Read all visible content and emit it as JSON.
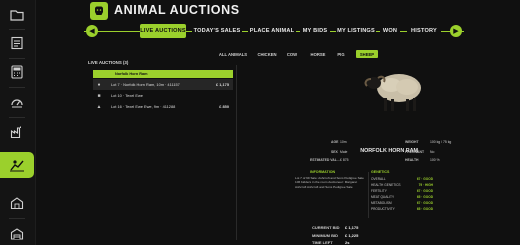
{
  "header": {
    "title": "ANIMAL AUCTIONS",
    "logo_icon": "cow-head-icon"
  },
  "tabs": {
    "prev_icon": "chevron-left-icon",
    "next_icon": "chevron-right-icon",
    "items": [
      {
        "label": "LIVE AUCTIONS",
        "active": true
      },
      {
        "label": "TODAY'S SALES",
        "active": false
      },
      {
        "label": "PLACE ANIMAL",
        "active": false
      },
      {
        "label": "MY BIDS",
        "active": false
      },
      {
        "label": "MY LISTINGS",
        "active": false
      },
      {
        "label": "WON",
        "active": false
      },
      {
        "label": "HISTORY",
        "active": false
      }
    ]
  },
  "filters": [
    {
      "label": "ALL ANIMALS",
      "active": false
    },
    {
      "label": "CHICKEN",
      "active": false
    },
    {
      "label": "COW",
      "active": false
    },
    {
      "label": "HORSE",
      "active": false
    },
    {
      "label": "PIG",
      "active": false
    },
    {
      "label": "SHEEP",
      "active": true
    }
  ],
  "auctions": {
    "title": "LIVE AUCTIONS (3)",
    "group_header": "Norfolk Horn Ram",
    "rows": [
      {
        "icon": "sheep-icon",
        "text": "Lot 7  ·  Norfolk Horn Ram, 10m  ·  411157",
        "price": "£ 1,175",
        "selected": true
      },
      {
        "icon": "cow-icon",
        "text": "Lot 10  ·  Texel Ewe",
        "price": "",
        "selected": false
      },
      {
        "icon": "horse-icon",
        "text": "Lot 16  ·  Texel Ewe Ewe, 9m  ·  411288",
        "price": "£ 850",
        "selected": false
      }
    ]
  },
  "details": {
    "animal_icon": "sheep-icon",
    "name": "NORFOLK HORN RAM",
    "stats": {
      "age_label": "AGE",
      "age_value": "10m",
      "weight_label": "WEIGHT",
      "weight_value": "100 kg / 75 kg",
      "sex_label": "SEX",
      "sex_value": "Male",
      "pregnant_label": "PREGNANT",
      "pregnant_value": "No",
      "est_label": "ESTIMATED VAL...",
      "est_value": "£ 875",
      "health_label": "HEALTH",
      "health_value": "100 %"
    },
    "information": {
      "title": "INFORMATION",
      "text": "Lot 7 of 99 Sale: Ashcroft and Sons Pedigree Sale 106 bidders in the room Auctioneer: Margaret Ashcroft Ashcroft and Sons Pedigree Sale"
    },
    "genetics": {
      "title": "GENETICS",
      "rows": [
        {
          "label": "OVERALL",
          "value": "67 · GOOD"
        },
        {
          "label": "HEALTH GENETICS",
          "value": "79 · HIGH"
        },
        {
          "label": "FERTILITY",
          "value": "67 · GOOD"
        },
        {
          "label": "MEAT QUALITY",
          "value": "65 · GOOD"
        },
        {
          "label": "METABOLISM",
          "value": "67 · GOOD"
        },
        {
          "label": "PRODUCTIVITY",
          "value": "65 · GOOD"
        }
      ]
    },
    "bids": {
      "current_label": "CURRENT BID",
      "current_value": "£ 1,175",
      "minimum_label": "MINIMUM BID",
      "minimum_value": "£ 1,225",
      "time_label": "TIME LEFT",
      "time_value": "2s"
    }
  },
  "sidebar": {
    "items": [
      {
        "icon": "folder-icon",
        "active": false
      },
      {
        "icon": "checklist-icon",
        "active": false
      },
      {
        "icon": "calculator-icon",
        "active": false
      },
      {
        "icon": "gauge-icon",
        "active": false
      },
      {
        "icon": "factory-icon",
        "active": false
      },
      {
        "icon": "tractor-icon",
        "active": false
      },
      {
        "icon": "animal-shop-icon",
        "active": true
      },
      {
        "icon": "barn-icon",
        "active": false
      },
      {
        "icon": "warehouse-icon",
        "active": false
      }
    ]
  },
  "colors": {
    "accent": "#9bd02c",
    "background": "#101010"
  }
}
